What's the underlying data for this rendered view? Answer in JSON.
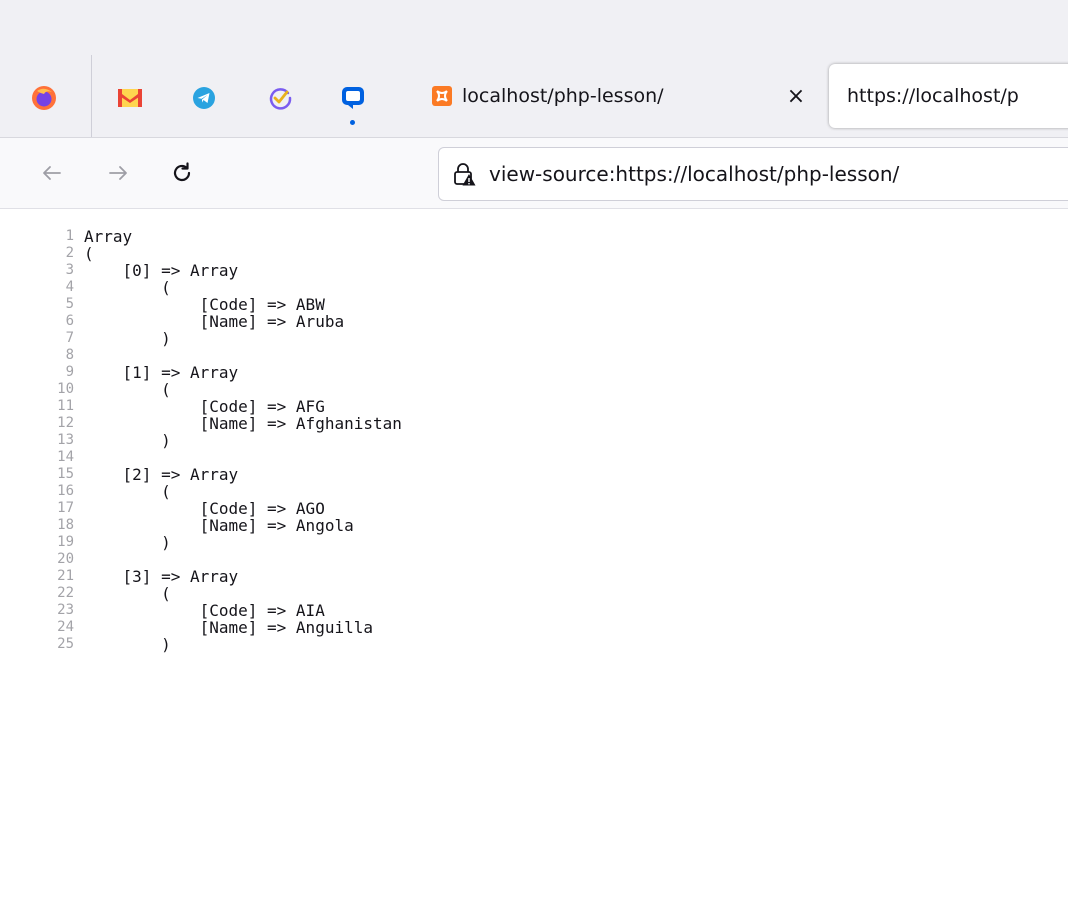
{
  "browser": {
    "pinned_tabs": [
      {
        "name": "firefox-icon"
      },
      {
        "name": "gmail-icon"
      },
      {
        "name": "telegram-icon"
      },
      {
        "name": "tasks-icon"
      },
      {
        "name": "chat-icon"
      }
    ],
    "tabs": [
      {
        "title": "localhost/php-lesson/",
        "active": false
      },
      {
        "title": "https://localhost/p",
        "active": true
      }
    ],
    "close_label": "×",
    "url": "view-source:https://localhost/php-lesson/",
    "colors": {
      "accent": "#0061e0",
      "xampp": "#fb7a24"
    }
  },
  "source": {
    "lines": [
      {
        "n": "1",
        "text": "Array"
      },
      {
        "n": "2",
        "text": "("
      },
      {
        "n": "3",
        "text": "    [0] => Array"
      },
      {
        "n": "4",
        "text": "        ("
      },
      {
        "n": "5",
        "text": "            [Code] => ABW"
      },
      {
        "n": "6",
        "text": "            [Name] => Aruba"
      },
      {
        "n": "7",
        "text": "        )"
      },
      {
        "n": "8",
        "text": ""
      },
      {
        "n": "9",
        "text": "    [1] => Array"
      },
      {
        "n": "10",
        "text": "        ("
      },
      {
        "n": "11",
        "text": "            [Code] => AFG"
      },
      {
        "n": "12",
        "text": "            [Name] => Afghanistan"
      },
      {
        "n": "13",
        "text": "        )"
      },
      {
        "n": "14",
        "text": ""
      },
      {
        "n": "15",
        "text": "    [2] => Array"
      },
      {
        "n": "16",
        "text": "        ("
      },
      {
        "n": "17",
        "text": "            [Code] => AGO"
      },
      {
        "n": "18",
        "text": "            [Name] => Angola"
      },
      {
        "n": "19",
        "text": "        )"
      },
      {
        "n": "20",
        "text": ""
      },
      {
        "n": "21",
        "text": "    [3] => Array"
      },
      {
        "n": "22",
        "text": "        ("
      },
      {
        "n": "23",
        "text": "            [Code] => AIA"
      },
      {
        "n": "24",
        "text": "            [Name] => Anguilla"
      },
      {
        "n": "25",
        "text": "        )"
      }
    ]
  }
}
